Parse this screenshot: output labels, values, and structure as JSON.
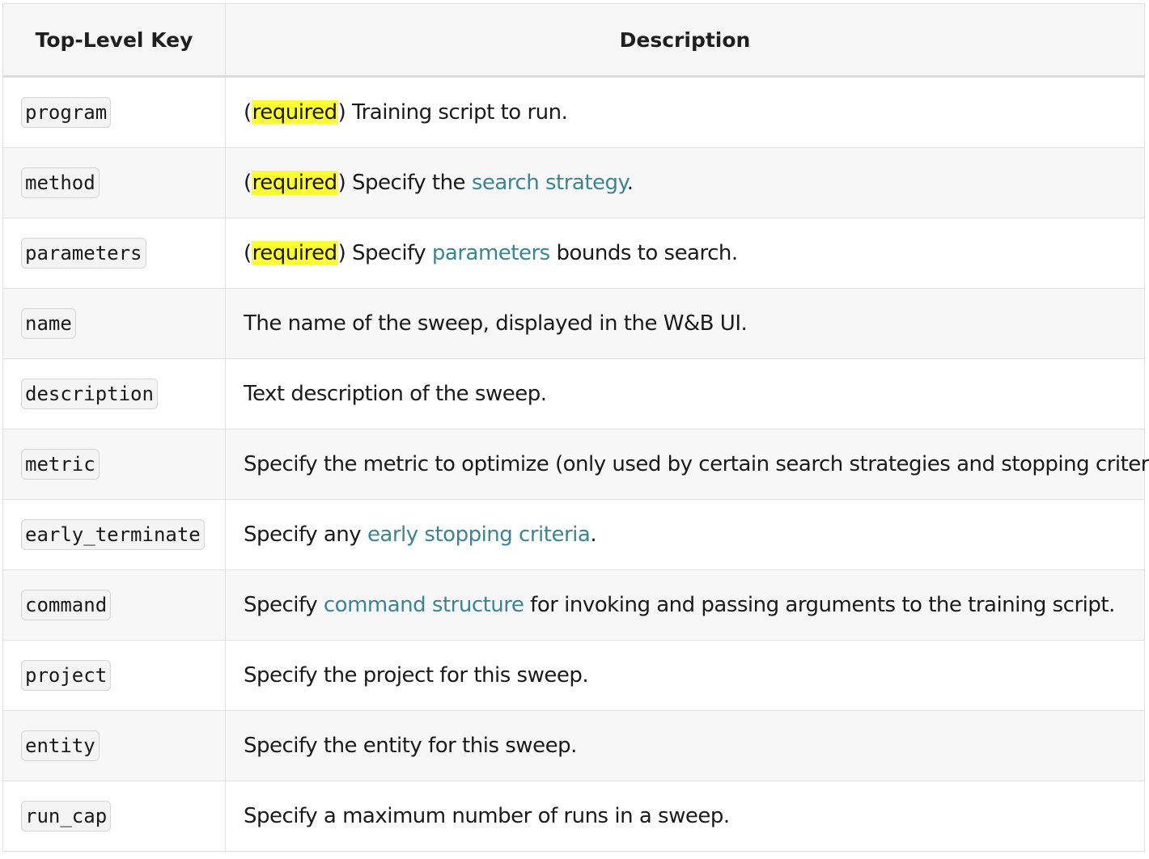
{
  "table": {
    "headers": {
      "key": "Top-Level Key",
      "description": "Description"
    },
    "rows": [
      {
        "key": "program",
        "pre": "(",
        "required": "required",
        "mid": ") Training script to run.",
        "link": "",
        "post": ""
      },
      {
        "key": "method",
        "pre": "(",
        "required": "required",
        "mid": ") Specify the ",
        "link": "search strategy",
        "post": "."
      },
      {
        "key": "parameters",
        "pre": "(",
        "required": "required",
        "mid": ") Specify ",
        "link": "parameters",
        "post": " bounds to search."
      },
      {
        "key": "name",
        "pre": "",
        "required": "",
        "mid": "The name of the sweep, displayed in the W&B UI.",
        "link": "",
        "post": ""
      },
      {
        "key": "description",
        "pre": "",
        "required": "",
        "mid": "Text description of the sweep.",
        "link": "",
        "post": ""
      },
      {
        "key": "metric",
        "pre": "",
        "required": "",
        "mid": "Specify the metric to optimize (only used by certain search strategies and stopping criteria).",
        "link": "",
        "post": ""
      },
      {
        "key": "early_terminate",
        "pre": "",
        "required": "",
        "mid": "Specify any ",
        "link": "early stopping criteria",
        "post": "."
      },
      {
        "key": "command",
        "pre": "",
        "required": "",
        "mid": "Specify ",
        "link": "command structure",
        "post": " for invoking and passing arguments to the training script."
      },
      {
        "key": "project",
        "pre": "",
        "required": "",
        "mid": "Specify the project for this sweep.",
        "link": "",
        "post": ""
      },
      {
        "key": "entity",
        "pre": "",
        "required": "",
        "mid": "Specify the entity for this sweep.",
        "link": "",
        "post": ""
      },
      {
        "key": "run_cap",
        "pre": "",
        "required": "",
        "mid": "Specify a maximum number of runs in a sweep.",
        "link": "",
        "post": ""
      }
    ]
  },
  "colors": {
    "link": "#3c8493",
    "highlight": "#ffff33"
  }
}
